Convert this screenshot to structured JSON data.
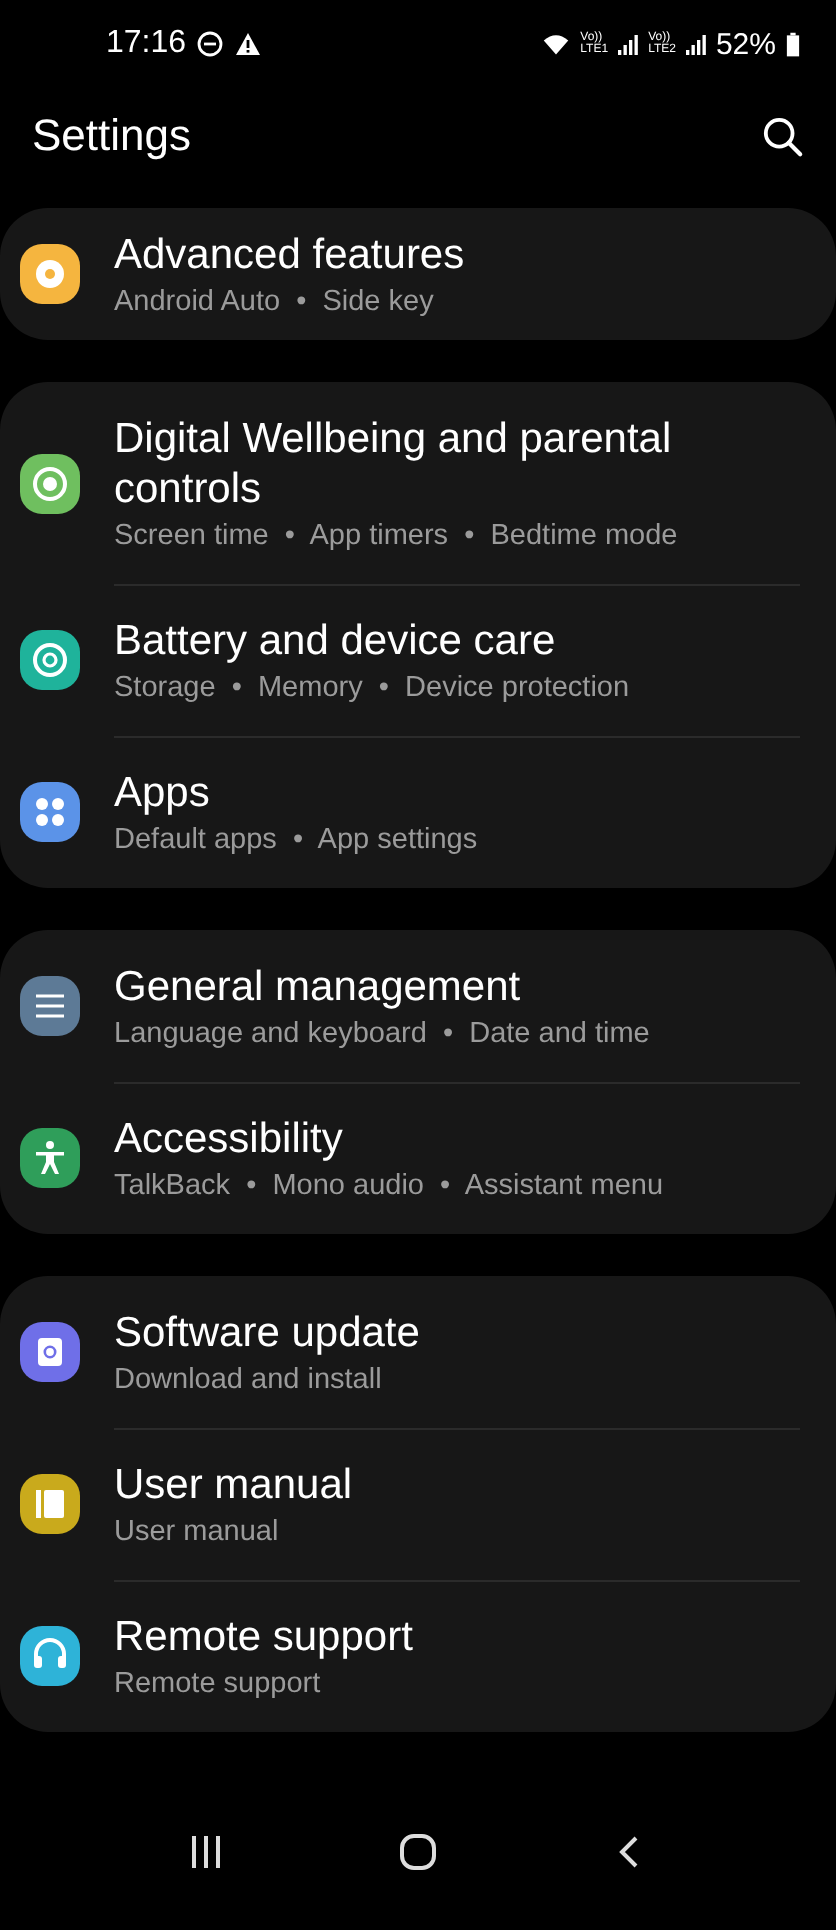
{
  "status_bar": {
    "time": "17:16",
    "volte_1": "Vo))",
    "lte_1": "LTE1",
    "volte_2": "Vo))",
    "lte_2": "LTE2",
    "battery": "52%"
  },
  "header": {
    "title": "Settings"
  },
  "groups": [
    {
      "items": [
        {
          "title": "Advanced features",
          "subtitle": "Android Auto  •  Side key",
          "color": "#f5b53f"
        }
      ]
    },
    {
      "items": [
        {
          "title": "Digital Wellbeing and parental controls",
          "subtitle": "Screen time  •  App timers  •  Bedtime mode",
          "color": "#6fbf5f"
        },
        {
          "title": "Battery and device care",
          "subtitle": "Storage  •  Memory  •  Device protection",
          "color": "#1fb39b"
        },
        {
          "title": "Apps",
          "subtitle": "Default apps  •  App settings",
          "color": "#5b93e8"
        }
      ]
    },
    {
      "items": [
        {
          "title": "General management",
          "subtitle": "Language and keyboard  •  Date and time",
          "color": "#5d7a96"
        },
        {
          "title": "Accessibility",
          "subtitle": "TalkBack  •  Mono audio  •  Assistant menu",
          "color": "#2f9e5a"
        }
      ]
    },
    {
      "items": [
        {
          "title": "Software update",
          "subtitle": "Download and install",
          "color": "#6f6fe8"
        },
        {
          "title": "User manual",
          "subtitle": "User manual",
          "color": "#c9aa1c"
        },
        {
          "title": "Remote support",
          "subtitle": "Remote support",
          "color": "#2eb3d8"
        }
      ]
    }
  ]
}
